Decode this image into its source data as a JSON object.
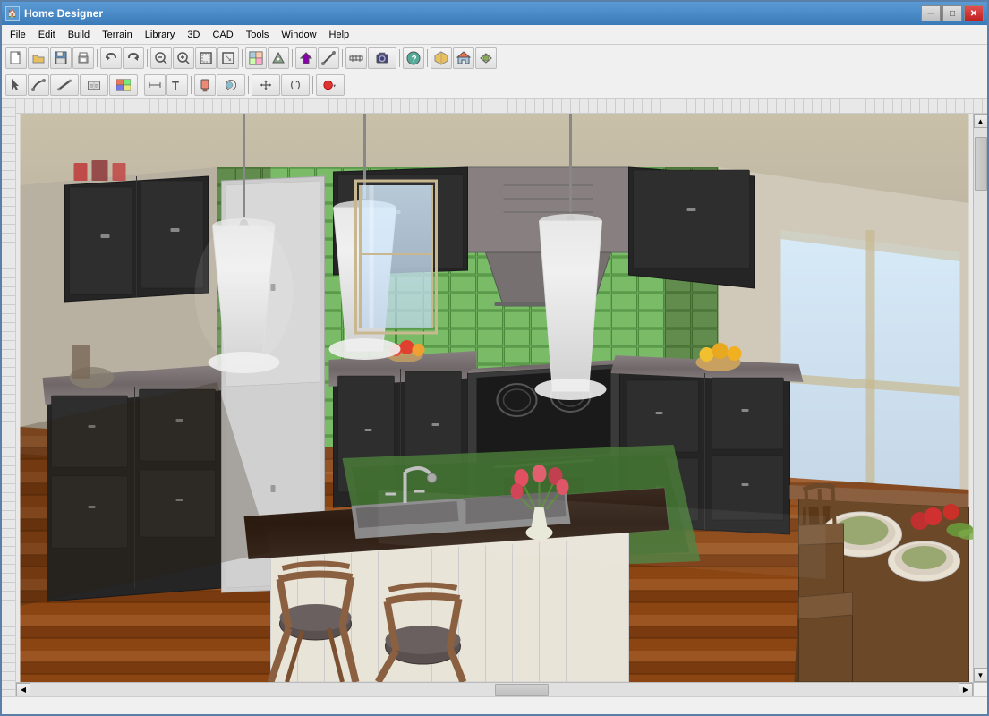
{
  "window": {
    "title": "Home Designer",
    "icon": "🏠"
  },
  "title_controls": {
    "minimize": "─",
    "maximize": "□",
    "close": "✕"
  },
  "menu": {
    "items": [
      "File",
      "Edit",
      "Build",
      "Terrain",
      "Library",
      "3D",
      "CAD",
      "Tools",
      "Window",
      "Help"
    ]
  },
  "toolbar1": {
    "buttons": [
      {
        "name": "new",
        "icon": "📄",
        "label": "New"
      },
      {
        "name": "open",
        "icon": "📂",
        "label": "Open"
      },
      {
        "name": "save",
        "icon": "💾",
        "label": "Save"
      },
      {
        "name": "print",
        "icon": "🖨",
        "label": "Print"
      },
      {
        "name": "sep1",
        "type": "sep"
      },
      {
        "name": "undo",
        "icon": "↩",
        "label": "Undo"
      },
      {
        "name": "redo",
        "icon": "↪",
        "label": "Redo"
      },
      {
        "name": "sep2",
        "type": "sep"
      },
      {
        "name": "zoom-out",
        "icon": "🔍-",
        "label": "Zoom Out"
      },
      {
        "name": "zoom-in",
        "icon": "🔍+",
        "label": "Zoom In"
      },
      {
        "name": "zoom-fit",
        "icon": "⊞",
        "label": "Zoom to Fit"
      },
      {
        "name": "zoom-select",
        "icon": "⊟",
        "label": "Zoom Select"
      },
      {
        "name": "sep3",
        "type": "sep"
      },
      {
        "name": "exterior",
        "icon": "🏠",
        "label": "Exterior"
      },
      {
        "name": "camera",
        "icon": "📷",
        "label": "Camera"
      },
      {
        "name": "sep4",
        "type": "sep"
      },
      {
        "name": "help",
        "icon": "?",
        "label": "Help"
      }
    ]
  },
  "toolbar2": {
    "buttons": [
      {
        "name": "select",
        "icon": "↖",
        "label": "Select"
      },
      {
        "name": "polyline",
        "icon": "⌒",
        "label": "Polyline"
      },
      {
        "name": "wall",
        "icon": "▬",
        "label": "Wall"
      },
      {
        "name": "cabinet",
        "icon": "⊟",
        "label": "Cabinet"
      },
      {
        "name": "material",
        "icon": "⬛",
        "label": "Material Painter"
      },
      {
        "name": "sep5",
        "type": "sep"
      },
      {
        "name": "dimension",
        "icon": "↔",
        "label": "Dimension"
      },
      {
        "name": "text",
        "icon": "T",
        "label": "Text"
      },
      {
        "name": "sep6",
        "type": "sep"
      },
      {
        "name": "paint",
        "icon": "🖌",
        "label": "Paint"
      },
      {
        "name": "fill",
        "icon": "⬡",
        "label": "Fill"
      },
      {
        "name": "sep7",
        "type": "sep"
      },
      {
        "name": "move",
        "icon": "✥",
        "label": "Move"
      },
      {
        "name": "rotate",
        "icon": "↻",
        "label": "Rotate"
      },
      {
        "name": "sep8",
        "type": "sep"
      },
      {
        "name": "record",
        "icon": "⏺",
        "label": "Record"
      }
    ]
  },
  "status": {
    "text": ""
  },
  "scene": {
    "description": "3D Kitchen render with dark cabinets, green tile backsplash, kitchen island with sink, pendant lights, bar stools, and dining area"
  }
}
